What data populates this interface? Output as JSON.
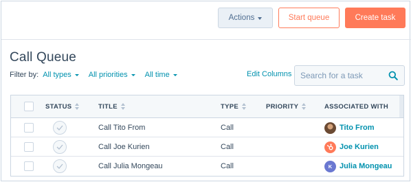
{
  "toolbar": {
    "actions_label": "Actions",
    "start_queue_label": "Start queue",
    "create_task_label": "Create task"
  },
  "page": {
    "title": "Call Queue"
  },
  "filters": {
    "label": "Filter by:",
    "types": "All types",
    "priorities": "All priorities",
    "time": "All time"
  },
  "edit_columns_label": "Edit Columns",
  "search": {
    "placeholder": "Search for a task",
    "value": ""
  },
  "table": {
    "columns": {
      "status": "STATUS",
      "title": "TITLE",
      "type": "TYPE",
      "priority": "PRIORITY",
      "associated": "ASSOCIATED WITH"
    },
    "rows": [
      {
        "title": "Call Tito From",
        "type": "Call",
        "priority": "",
        "associated": "Tito From",
        "avatar": "photo",
        "avatar_color": "#8a6a4a",
        "avatar_text": ""
      },
      {
        "title": "Call Joe Kurien",
        "type": "Call",
        "priority": "",
        "associated": "Joe Kurien",
        "avatar": "hubspot-sprocket-icon",
        "avatar_color": "#ff7a59",
        "avatar_text": ""
      },
      {
        "title": "Call Julia Mongeau",
        "type": "Call",
        "priority": "",
        "associated": "Julia Mongeau",
        "avatar": "initial",
        "avatar_color": "#6a78d1",
        "avatar_text": "K"
      }
    ]
  },
  "colors": {
    "accent": "#ff7a59",
    "link": "#0091ae",
    "text": "#33475b"
  }
}
